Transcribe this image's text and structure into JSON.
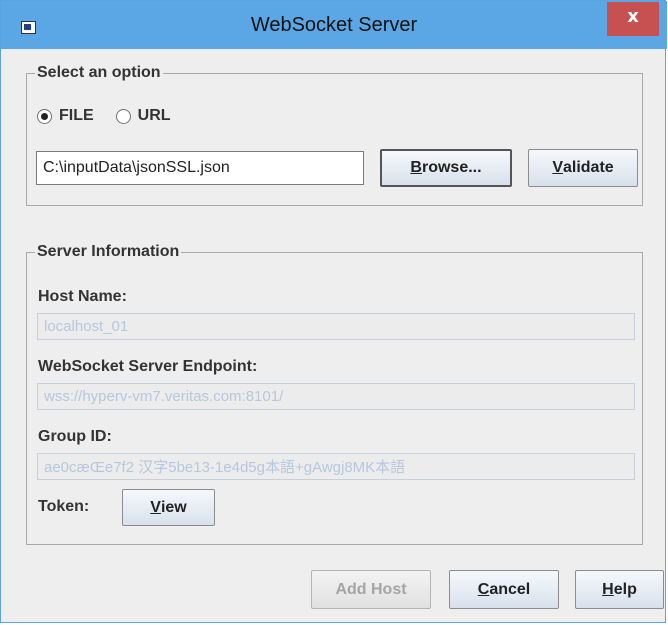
{
  "window": {
    "title": "WebSocket Server",
    "close_glyph": "x",
    "icon": "java-app-icon"
  },
  "option_group": {
    "legend": "Select an option",
    "radios": [
      {
        "label": "FILE",
        "checked": true
      },
      {
        "label": "URL",
        "checked": false
      }
    ],
    "path_value": "C:\\inputData\\jsonSSL.json",
    "browse": {
      "mnemonic": "B",
      "rest": "rowse..."
    },
    "validate": {
      "mnemonic": "V",
      "rest": "alidate"
    }
  },
  "server_group": {
    "legend": "Server Information",
    "host_label": "Host Name:",
    "host_value": "localhost_01",
    "endpoint_label": "WebSocket Server Endpoint:",
    "endpoint_value": "wss://hyperv-vm7.veritas.com:8101/",
    "group_label": "Group ID:",
    "group_value": "ae0cæŒe7f2 汉字5be13-1e4d5g本語+gAwgj8MK本語",
    "token_label": "Token:",
    "view": {
      "mnemonic": "V",
      "rest": "iew"
    }
  },
  "footer": {
    "add_host": "Add Host",
    "cancel": {
      "mnemonic": "C",
      "rest": "ancel"
    },
    "help": {
      "mnemonic": "H",
      "rest": "elp"
    }
  }
}
